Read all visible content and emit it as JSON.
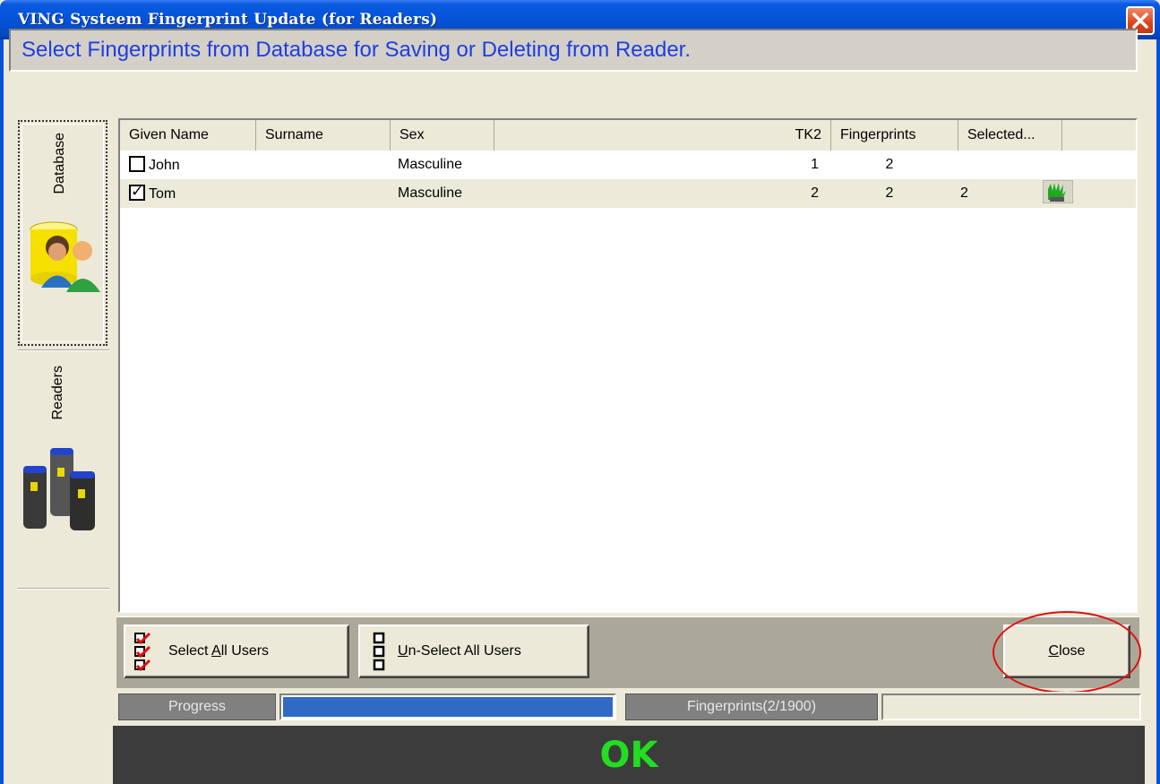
{
  "window": {
    "title": "VING Systeem Fingerprint Update (for Readers)"
  },
  "header": {
    "instruction": "Select Fingerprints from Database for Saving or Deleting from Reader."
  },
  "sidebar": {
    "tabs": [
      {
        "label": "Database",
        "icon": "database-users-icon",
        "active": true
      },
      {
        "label": "Readers",
        "icon": "fingerprint-readers-icon",
        "active": false
      }
    ]
  },
  "grid": {
    "columns": [
      "Given Name",
      "Surname",
      "Sex",
      "TK2",
      "Fingerprints",
      "Selected..."
    ],
    "rows": [
      {
        "checked": false,
        "given_name": "John",
        "surname": "",
        "sex": "Masculine",
        "tk2": "1",
        "fingerprints": "2",
        "selected": "",
        "icon": ""
      },
      {
        "checked": true,
        "given_name": "Tom",
        "surname": "",
        "sex": "Masculine",
        "tk2": "2",
        "fingerprints": "2",
        "selected": "2",
        "icon": "green-hand-icon"
      }
    ]
  },
  "toolbar": {
    "select_all_pre": "Select ",
    "select_all_key": "A",
    "select_all_post": "ll Users",
    "unselect_all_key": "U",
    "unselect_all_post": "n-Select All Users",
    "close_key": "C",
    "close_post": "lose"
  },
  "progress": {
    "label": "Progress",
    "fraction": 1.0,
    "fingerprints_label": "Fingerprints(2/1900)"
  },
  "status": {
    "text": "OK",
    "color": "#22dd22"
  },
  "colors": {
    "title_bar": "#0453d8",
    "instruction_text": "#1d3ee0",
    "progress_fill": "#316ac5",
    "highlight": "#e01010"
  }
}
